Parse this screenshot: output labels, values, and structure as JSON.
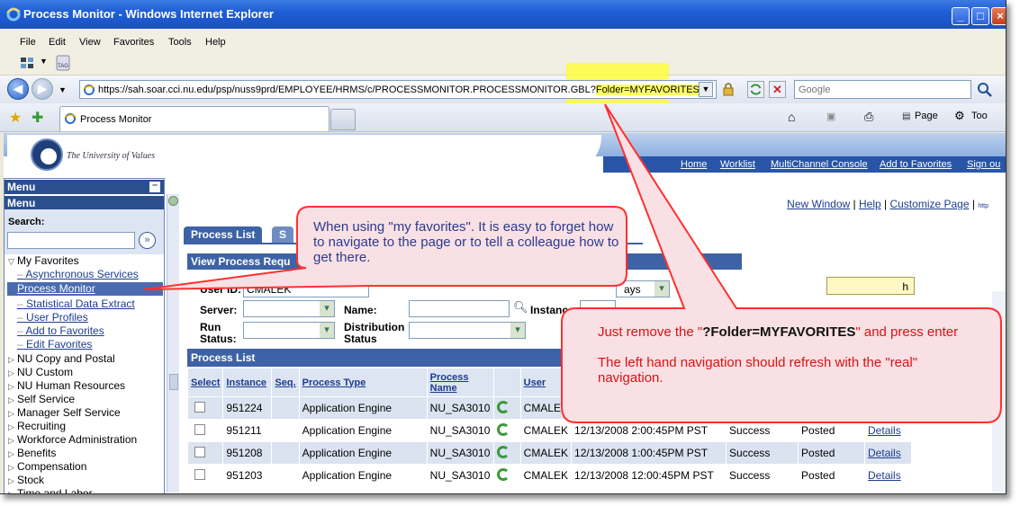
{
  "window": {
    "title": "Process Monitor - Windows Internet Explorer"
  },
  "menu": [
    "File",
    "Edit",
    "View",
    "Favorites",
    "Tools",
    "Help"
  ],
  "address": {
    "url_prefix": "https://sah.soar.cci.nu.edu/psp/nuss9prd/EMPLOYEE/HRMS/c/PROCESSMONITOR.PROCESSMONITOR.GBL?",
    "url_highlight": "Folder=MYFAVORITES",
    "search_placeholder": "Google"
  },
  "browser_tab": {
    "label": "Process Monitor"
  },
  "command_bar": {
    "page": "Page",
    "tools": "Too"
  },
  "site": {
    "tagline": "The University of Values",
    "links": [
      "Home",
      "Worklist",
      "MultiChannel Console",
      "Add to Favorites",
      "Sign ou"
    ]
  },
  "nav": {
    "header1": "Menu",
    "header2": "Menu",
    "search_label": "Search:",
    "favorites_label": "My Favorites",
    "favorites": [
      "Asynchronous Services",
      "Process Monitor",
      "Statistical Data Extract",
      "User Profiles",
      "Add to Favorites",
      "Edit Favorites"
    ],
    "folders": [
      "NU Copy and Postal",
      "NU Custom",
      "NU Human Resources",
      "Self Service",
      "Manager Self Service",
      "Recruiting",
      "Workforce Administration",
      "Benefits",
      "Compensation",
      "Stock",
      "Time and Labor"
    ]
  },
  "page_links": {
    "new_window": "New Window",
    "help": "Help",
    "customize": "Customize Page",
    "http": "http"
  },
  "tabs": {
    "process_list": "Process List",
    "server_list": "S"
  },
  "view_process": {
    "title": "View Process Requ",
    "user_id_label": "User ID:",
    "user_id_value": "CMALEK",
    "days_value": "ays",
    "refresh_label": "h",
    "server_label": "Server:",
    "name_label": "Name:",
    "instance_label": "Instance:",
    "run_status_label": "Run Status:",
    "dist_status_label": "Distribution Status"
  },
  "process_list": {
    "title": "Process List",
    "columns": [
      "Select",
      "Instance",
      "Seq.",
      "Process Type",
      "Process Name",
      "",
      "User",
      "",
      "",
      "",
      ""
    ],
    "rows": [
      {
        "instance": "951224",
        "type": "Application Engine",
        "name": "NU_SA3010",
        "user": "CMALEK",
        "date": "",
        "status": "",
        "dist": "",
        "details": ""
      },
      {
        "instance": "951211",
        "type": "Application Engine",
        "name": "NU_SA3010",
        "user": "CMALEK",
        "date": "12/13/2008 2:00:45PM PST",
        "status": "Success",
        "dist": "Posted",
        "details": "Details"
      },
      {
        "instance": "951208",
        "type": "Application Engine",
        "name": "NU_SA3010",
        "user": "CMALEK",
        "date": "12/13/2008 1:00:45PM PST",
        "status": "Success",
        "dist": "Posted",
        "details": "Details"
      },
      {
        "instance": "951203",
        "type": "Application Engine",
        "name": "NU_SA3010",
        "user": "CMALEK",
        "date": "12/13/2008 12:00:45PM PST",
        "status": "Success",
        "dist": "Posted",
        "details": "Details"
      }
    ]
  },
  "callout1": {
    "text": "When using \"my favorites\". It is easy to forget how to navigate to the page or to tell a colleague how to get there."
  },
  "callout2": {
    "line1_pre": "Just remove the \"",
    "line1_bold": "?Folder=MYFAVORITES",
    "line1_post": "\" and press enter",
    "line2": "The left hand navigation should refresh with the \"real\" navigation."
  },
  "colors": {
    "title_bar": "#1f5ed6",
    "peoplesoft_blue": "#3e62a6",
    "highlight": "#ffff66",
    "callout_fill": "#f9e0e4",
    "callout_stroke": "#ff3030"
  }
}
